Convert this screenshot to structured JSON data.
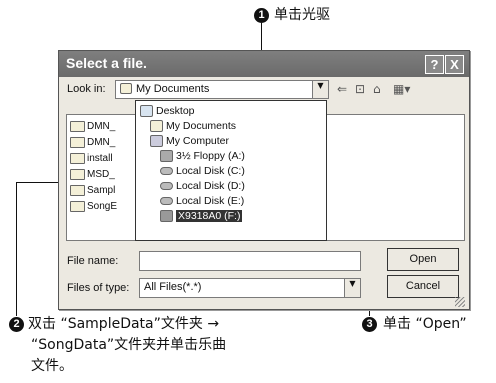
{
  "callouts": {
    "c1": {
      "num": "1",
      "text": "单击光驱"
    },
    "c2": {
      "num": "2",
      "line1": "双击 “SampleData”文件夹 →",
      "line2": "“SongData”文件夹并单击乐曲",
      "line3": "文件。"
    },
    "c3": {
      "num": "3",
      "text": "单击 “Open”"
    }
  },
  "dialog": {
    "title": "Select a file.",
    "help_label": "?",
    "close_label": "X",
    "lookin_label": "Look in:",
    "lookin_value": "My Documents",
    "files": [
      "DMN_",
      "DMN_",
      "install",
      "MSD_",
      "Sampl",
      "SongE"
    ],
    "dropdown_items": [
      "Desktop",
      "My Documents",
      "My Computer",
      "3½ Floppy (A:)",
      "Local Disk (C:)",
      "Local Disk (D:)",
      "Local Disk (E:)",
      "X9318A0 (F:)"
    ],
    "selected_item": "X9318A0 (F:)",
    "filename_label": "File name:",
    "filename_value": "",
    "filetype_label": "Files of type:",
    "filetype_value": "All Files(*.*)",
    "open_label": "Open",
    "cancel_label": "Cancel"
  }
}
